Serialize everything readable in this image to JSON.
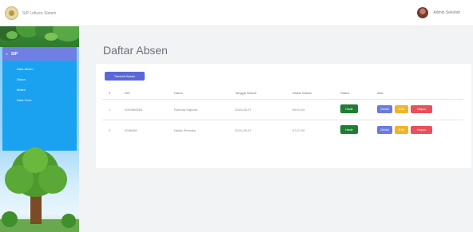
{
  "app": {
    "title": "SIP Lettuce Sistem"
  },
  "user": {
    "name": "Admin Sekolah"
  },
  "sidebar": {
    "section": "SIP",
    "items": [
      {
        "label": "Data Absen"
      },
      {
        "label": "Siswa"
      },
      {
        "label": "Materi"
      },
      {
        "label": "Data Guru"
      }
    ]
  },
  "page": {
    "title": "Daftar Absen"
  },
  "toolbar": {
    "add_label": "Tambah Absen"
  },
  "table": {
    "headers": [
      "#",
      "NIS",
      "Nama",
      "Tanggal Masuk",
      "Waktu Masuk",
      "Status",
      "Aksi"
    ],
    "rows": [
      {
        "no": "1",
        "nis": "0003568284",
        "nama": "Rahmat Saputra",
        "tanggal": "2024-05-07",
        "waktu": "08:01:00",
        "status": "Hadir"
      },
      {
        "no": "2",
        "nis": "0038456",
        "nama": "Nadia Permata",
        "tanggal": "2024-05-07",
        "waktu": "07:47:00",
        "status": "Hadir"
      }
    ],
    "actions": {
      "detail": "Detail",
      "edit": "Edit",
      "hapus": "Hapus"
    }
  },
  "colors": {
    "accent": "#5a67d8",
    "sidebar_menu": "#1aa2f0",
    "status_hadir": "#1e7e34",
    "detail": "#6c7ae0",
    "edit": "#f0b429",
    "hapus": "#e8505b"
  },
  "icons": {
    "logo": "school-logo-icon",
    "avatar": "user-avatar",
    "section": "home-icon"
  }
}
